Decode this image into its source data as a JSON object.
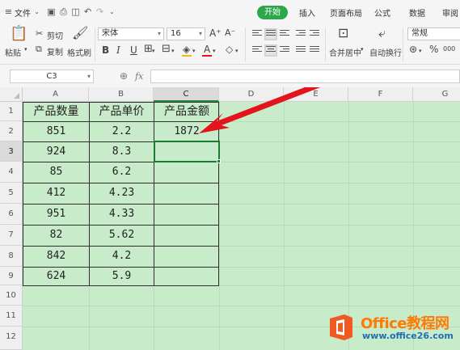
{
  "menubar": {
    "menu_icon": "hamburger-icon",
    "file_label": "文件",
    "tabs": [
      "开始",
      "插入",
      "页面布局",
      "公式",
      "数据",
      "审阅"
    ],
    "active_tab": "开始"
  },
  "ribbon": {
    "paste_label": "粘贴",
    "cut_label": "剪切",
    "copy_label": "复制",
    "format_painter_label": "格式刷",
    "font_name": "宋体",
    "font_size": "16",
    "bold": "B",
    "italic": "I",
    "underline": "U",
    "merge_label": "合并居中",
    "wrap_label": "自动换行",
    "number_format": "常规",
    "percent": "%",
    "thousands": "000"
  },
  "formula_bar": {
    "name_box": "C3",
    "zoom_icon": "zoom-icon",
    "fx_label": "fx",
    "formula_value": ""
  },
  "grid": {
    "columns": [
      "A",
      "B",
      "C",
      "D",
      "E",
      "F",
      "G"
    ],
    "rows": [
      "1",
      "2",
      "3",
      "4",
      "5",
      "6",
      "7",
      "8",
      "9",
      "10",
      "11",
      "12"
    ],
    "selected_column": "C",
    "selected_row": "3",
    "headers": [
      "产品数量",
      "产品单价",
      "产品金额"
    ],
    "data": [
      [
        "851",
        "2.2",
        "1872"
      ],
      [
        "924",
        "8.3",
        ""
      ],
      [
        "85",
        "6.2",
        ""
      ],
      [
        "412",
        "4.23",
        ""
      ],
      [
        "951",
        "4.33",
        ""
      ],
      [
        "82",
        "5.62",
        ""
      ],
      [
        "842",
        "4.2",
        ""
      ],
      [
        "624",
        "5.9",
        ""
      ]
    ],
    "sheet_color": "#c8ebc9",
    "arrow_color": "#e3141c"
  },
  "watermark": {
    "title": "Office教程网",
    "url": "www.office26.com",
    "brand_color": "#ff7a00"
  }
}
